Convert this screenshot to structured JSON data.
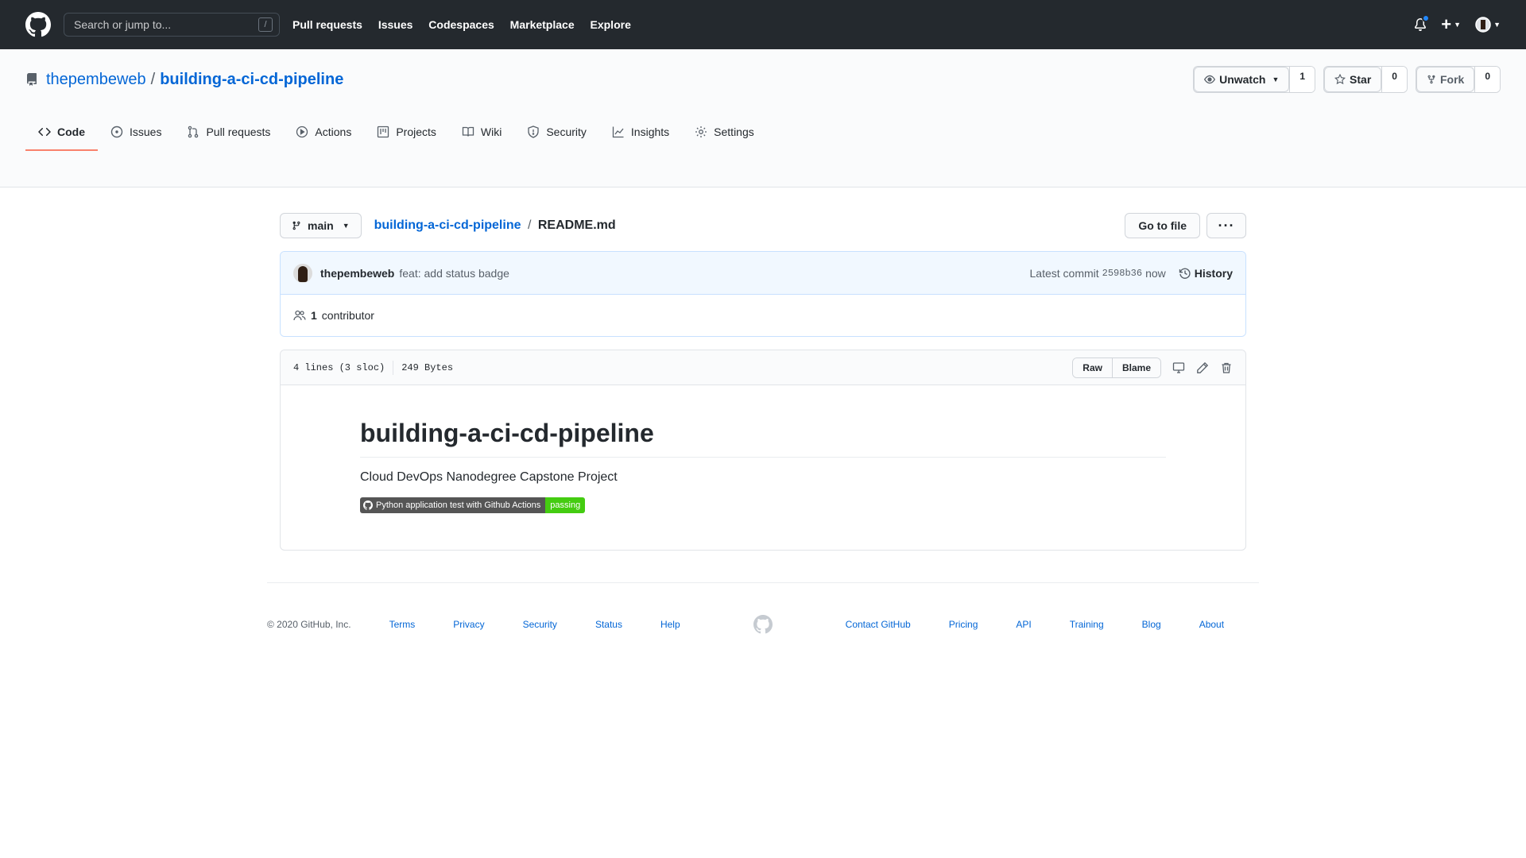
{
  "header": {
    "search_placeholder": "Search or jump to...",
    "search_shortcut": "/",
    "nav": [
      "Pull requests",
      "Issues",
      "Codespaces",
      "Marketplace",
      "Explore"
    ],
    "plus_label": "+"
  },
  "repo": {
    "owner": "thepembeweb",
    "separator": "/",
    "name": "building-a-ci-cd-pipeline",
    "actions": {
      "watch_label": "Unwatch",
      "watch_count": "1",
      "star_label": "Star",
      "star_count": "0",
      "fork_label": "Fork",
      "fork_count": "0"
    },
    "tabs": [
      {
        "label": "Code",
        "icon": "code-icon",
        "selected": true
      },
      {
        "label": "Issues",
        "icon": "issue-icon"
      },
      {
        "label": "Pull requests",
        "icon": "pull-request-icon"
      },
      {
        "label": "Actions",
        "icon": "play-icon"
      },
      {
        "label": "Projects",
        "icon": "project-icon"
      },
      {
        "label": "Wiki",
        "icon": "book-icon"
      },
      {
        "label": "Security",
        "icon": "shield-icon"
      },
      {
        "label": "Insights",
        "icon": "graph-icon"
      },
      {
        "label": "Settings",
        "icon": "gear-icon"
      }
    ]
  },
  "file_nav": {
    "branch": "main",
    "breadcrumb_repo": "building-a-ci-cd-pipeline",
    "breadcrumb_sep": "/",
    "breadcrumb_file": "README.md",
    "go_to_file": "Go to file",
    "more": "···"
  },
  "commit": {
    "author": "thepembeweb",
    "message": "feat: add status badge",
    "latest_label": "Latest commit",
    "sha": "2598b36",
    "time": "now",
    "history": "History",
    "contributor_count": "1",
    "contributor_label": "contributor"
  },
  "blob": {
    "lines": "4 lines (3 sloc)",
    "size": "249 Bytes",
    "raw": "Raw",
    "blame": "Blame"
  },
  "readme": {
    "title": "building-a-ci-cd-pipeline",
    "description": "Cloud DevOps Nanodegree Capstone Project",
    "badge_label": "Python application test with Github Actions",
    "badge_status": "passing"
  },
  "footer": {
    "copyright": "© 2020 GitHub, Inc.",
    "left_links": [
      "Terms",
      "Privacy",
      "Security",
      "Status",
      "Help"
    ],
    "right_links": [
      "Contact GitHub",
      "Pricing",
      "API",
      "Training",
      "Blog",
      "About"
    ]
  },
  "colors": {
    "header_bg": "#24292e",
    "link": "#0366d6",
    "selected_tab_underline": "#f9826c",
    "badge_passing": "#44cc11"
  }
}
